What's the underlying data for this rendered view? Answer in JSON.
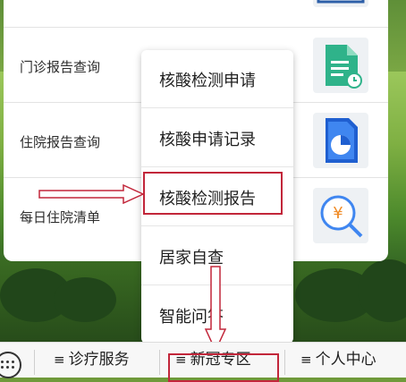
{
  "list": {
    "rows": [
      {
        "label": ""
      },
      {
        "label": "门诊报告查询"
      },
      {
        "label": "住院报告查询"
      },
      {
        "label": "每日住院清单"
      }
    ]
  },
  "popup_menu": {
    "items": [
      {
        "label": "核酸检测申请"
      },
      {
        "label": "核酸申请记录"
      },
      {
        "label": "核酸检测报告"
      },
      {
        "label": "居家自查"
      },
      {
        "label": "智能问答"
      }
    ],
    "highlighted_item": "核酸检测报告"
  },
  "bottom_bar": {
    "keyboard_icon": "keyboard-icon",
    "tabs": [
      {
        "label": "诊疗服务",
        "icon": "menu-icon"
      },
      {
        "label": "新冠专区",
        "icon": "menu-icon"
      },
      {
        "label": "个人中心",
        "icon": "menu-icon"
      }
    ],
    "active_tab": "新冠专区"
  },
  "annotation_color": "#c2263a"
}
